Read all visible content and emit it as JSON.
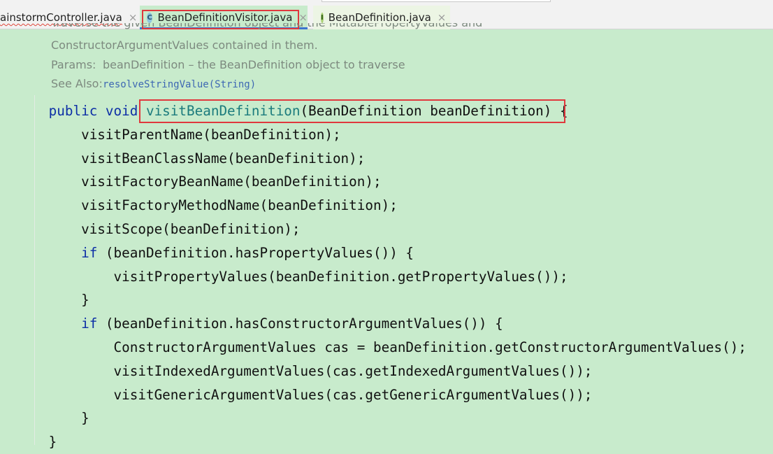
{
  "tabs": [
    {
      "label": "ainstormController.java",
      "close": "×",
      "icon": ""
    },
    {
      "label": "BeanDefinitionVisitor.java",
      "close": "×",
      "icon": "C"
    },
    {
      "label": "BeanDefinition.java",
      "close": "×",
      "icon": "I"
    }
  ],
  "doc": {
    "line0": "Traverse the given BeanDefinition object and the MutablePropertyValues and",
    "line1": "ConstructorArgumentValues contained in them.",
    "params_key": "Params:",
    "params_val": "beanDefinition – the BeanDefinition object to traverse",
    "see_key": "See Also:",
    "see_link": "resolveStringValue(String)"
  },
  "code": {
    "sig_kw": "public void ",
    "sig_name": "visitBeanDefinition",
    "sig_args": "(BeanDefinition beanDefinition)",
    "sig_brace": " {",
    "l1": "    visitParentName(beanDefinition);",
    "l2": "    visitBeanClassName(beanDefinition);",
    "l3": "    visitFactoryBeanName(beanDefinition);",
    "l4": "    visitFactoryMethodName(beanDefinition);",
    "l5": "    visitScope(beanDefinition);",
    "l6_kw": "if",
    "l6_rest": " (beanDefinition.hasPropertyValues()) {",
    "l7": "        visitPropertyValues(beanDefinition.getPropertyValues());",
    "l8": "    }",
    "l9_kw": "if",
    "l9_rest": " (beanDefinition.hasConstructorArgumentValues()) {",
    "l10": "        ConstructorArgumentValues cas = beanDefinition.getConstructorArgumentValues();",
    "l11": "        visitIndexedArgumentValues(cas.getIndexedArgumentValues());",
    "l12": "        visitGenericArgumentValues(cas.getGenericArgumentValues());",
    "l13": "    }",
    "l14": "}"
  },
  "colors": {
    "editor_bg": "#c8ebcc",
    "keyword": "#0d2fa6",
    "method_decl": "#1b7b7d",
    "highlight_box": "#e0383d",
    "active_tab_underline": "#3c74cf"
  }
}
